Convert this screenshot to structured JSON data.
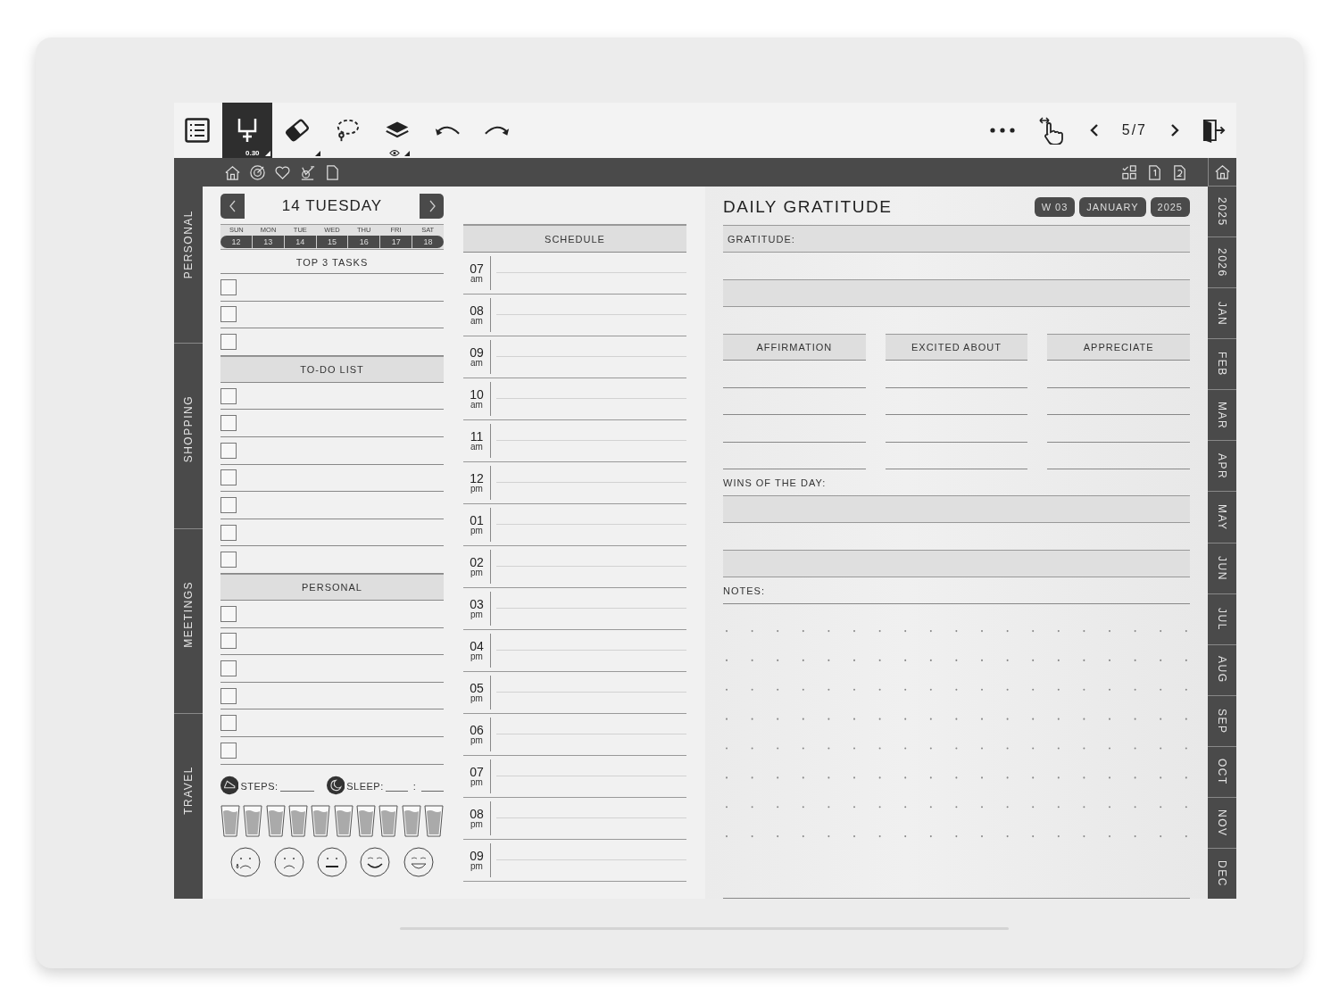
{
  "toolbar": {
    "tools": [
      {
        "kind": "pen",
        "selected": true,
        "size": "0.30"
      },
      {
        "kind": "eraser",
        "selected": false
      },
      {
        "kind": "lasso",
        "selected": false
      },
      {
        "kind": "layers",
        "selected": false
      }
    ],
    "actions": [
      {
        "kind": "undo"
      },
      {
        "kind": "redo"
      }
    ],
    "page": "5/7"
  },
  "left_tabs": [
    "PERSONAL",
    "SHOPPING",
    "MEETINGS",
    "TRAVEL"
  ],
  "right_tabs": [
    "2025",
    "2026",
    "JAN",
    "FEB",
    "MAR",
    "APR",
    "MAY",
    "JUN",
    "JUL",
    "AUG",
    "SEP",
    "OCT",
    "NOV",
    "DEC"
  ],
  "day": {
    "title": "14 TUESDAY",
    "week": [
      {
        "day": "SUN",
        "date": "12"
      },
      {
        "day": "MON",
        "date": "13"
      },
      {
        "day": "TUE",
        "date": "14"
      },
      {
        "day": "WED",
        "date": "15"
      },
      {
        "day": "THU",
        "date": "16"
      },
      {
        "day": "FRI",
        "date": "17"
      },
      {
        "day": "SAT",
        "date": "18"
      }
    ]
  },
  "sections": [
    {
      "title": "TOP 3 TASKS",
      "kind": "plain",
      "tasks": [
        {
          "checked": false
        },
        {
          "checked": false
        },
        {
          "checked": false
        }
      ]
    },
    {
      "title": "TO-DO LIST",
      "kind": "shaded",
      "tasks": [
        {
          "checked": false
        },
        {
          "checked": false
        },
        {
          "checked": false
        },
        {
          "checked": false
        },
        {
          "checked": false
        },
        {
          "checked": false
        },
        {
          "checked": false
        }
      ]
    },
    {
      "title": "PERSONAL",
      "kind": "shaded",
      "tasks": [
        {
          "checked": false
        },
        {
          "checked": false
        },
        {
          "checked": false
        },
        {
          "checked": false
        },
        {
          "checked": false
        },
        {
          "checked": false
        }
      ]
    }
  ],
  "trackers": {
    "steps": "STEPS:",
    "sleep": "SLEEP:",
    "separator": ":"
  },
  "schedule": {
    "title": "SCHEDULE",
    "hours": [
      {
        "hour": "07",
        "period": "am"
      },
      {
        "hour": "08",
        "period": "am"
      },
      {
        "hour": "09",
        "period": "am"
      },
      {
        "hour": "10",
        "period": "am"
      },
      {
        "hour": "11",
        "period": "am"
      },
      {
        "hour": "12",
        "period": "pm"
      },
      {
        "hour": "01",
        "period": "pm"
      },
      {
        "hour": "02",
        "period": "pm"
      },
      {
        "hour": "03",
        "period": "pm"
      },
      {
        "hour": "04",
        "period": "pm"
      },
      {
        "hour": "05",
        "period": "pm"
      },
      {
        "hour": "06",
        "period": "pm"
      },
      {
        "hour": "07",
        "period": "pm"
      },
      {
        "hour": "08",
        "period": "pm"
      },
      {
        "hour": "09",
        "period": "pm"
      }
    ]
  },
  "gratitude": {
    "title": "DAILY GRATITUDE",
    "badges": [
      "W 03",
      "JANUARY",
      "2025"
    ],
    "gratitude_label": "GRATITUDE:",
    "columns": [
      "AFFIRMATION",
      "EXCITED ABOUT",
      "APPRECIATE"
    ],
    "wins_label": "WINS OF THE DAY:",
    "notes_label": "NOTES:"
  }
}
